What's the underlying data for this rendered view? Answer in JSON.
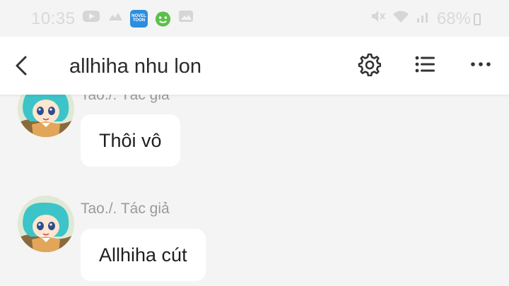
{
  "status_bar": {
    "time": "10:35",
    "battery": "68%",
    "left_icons": [
      "youtube-icon",
      "cloud-icon",
      "noveltoon-app-icon",
      "app-face-icon",
      "image-icon"
    ],
    "noveltoon_chip": "NOVEL TOON",
    "right_icons": [
      "mute-icon",
      "wifi-icon",
      "signal-icon",
      "battery-icon"
    ]
  },
  "header": {
    "title": "allhiha nhu lon",
    "back_icon": "chevron-left-icon",
    "actions": [
      "gear-icon",
      "list-icon",
      "more-icon"
    ]
  },
  "messages": [
    {
      "author": "Tao./. Tác giả",
      "text": "Thôi vô"
    },
    {
      "author": "Tao./. Tác giả",
      "text": "Allhiha cút"
    }
  ],
  "colors": {
    "background": "#f4f4f4",
    "header_bg": "#ffffff",
    "bubble_bg": "#ffffff",
    "author_text": "#9a9a9a",
    "status_text": "#d9d9d9"
  }
}
